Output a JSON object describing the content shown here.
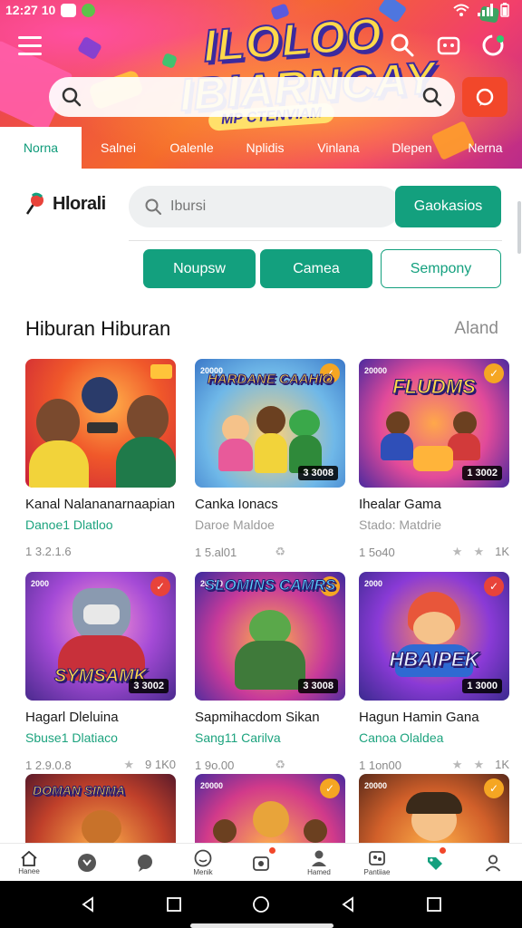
{
  "status_bar": {
    "time": "12:27 10"
  },
  "hero": {
    "title_line1": "ILOLOO",
    "title_line2": "IBIARNCAY",
    "subtitle": "MP CTENVIAM",
    "accent": "#f46a2a"
  },
  "categories": [
    {
      "label": "Norna",
      "active": true
    },
    {
      "label": "Salnei"
    },
    {
      "label": "Oalenle"
    },
    {
      "label": "Nplidis"
    },
    {
      "label": "Vinlana"
    },
    {
      "label": "Dlepen"
    },
    {
      "label": "Nerna"
    }
  ],
  "brand": {
    "name": "Hlorali"
  },
  "search": {
    "placeholder": "Ibursi",
    "button": "Gaokasios"
  },
  "filters": [
    "Noupsw",
    "Camea",
    "Sempony"
  ],
  "section": {
    "title": "Hiburan Hiburan",
    "link": "Aland"
  },
  "cards": [
    {
      "title": "Kanal Nalananarnaapiani,",
      "sub": "Danoe1 Dlatloo",
      "meta": "1 3.2.1.6",
      "tag": "",
      "badge": "",
      "art": ""
    },
    {
      "title": "Canka Ionacs",
      "sub": "Daroe Maldoe",
      "meta": "1 5.al01",
      "tag": "20000",
      "badge": "3 3008",
      "art": "HARDANE CAAHIO"
    },
    {
      "title": "Ihealar Gama",
      "sub": "Stado: Matdrie",
      "meta": "1 5o40",
      "tag": "20000",
      "badge": "1 3002",
      "art": "FLUDMS"
    },
    {
      "title": "Hagarl Dleluina",
      "sub": "Sbuse1 Dlatiaco",
      "meta": "1 2.9.0.8",
      "tag": "2000",
      "badge": "3 3002",
      "art": "SYMSAMK"
    },
    {
      "title": "Sapmihacdom Sikan",
      "sub": "Sang11 Carilva",
      "meta": "1 9o.00",
      "tag": "20000",
      "badge": "3 3008",
      "art": "SLOMINS CAMRS"
    },
    {
      "title": "Hagun Hamin Gana",
      "sub": "Canoa Olaldea",
      "meta": "1 1on00",
      "tag": "2000",
      "badge": "1 3000",
      "art": "HBAIPEK"
    },
    {
      "title": "",
      "sub": "",
      "meta": "",
      "tag": "",
      "badge": "",
      "art": "DOMAN SINMA"
    },
    {
      "title": "",
      "sub": "",
      "meta": "",
      "tag": "20000",
      "badge": "",
      "art": ""
    },
    {
      "title": "",
      "sub": "",
      "meta": "",
      "tag": "20000",
      "badge": "",
      "art": ""
    }
  ],
  "bottom_nav": [
    {
      "label": "Hanee",
      "icon": "home-icon"
    },
    {
      "label": "",
      "icon": "shield-icon"
    },
    {
      "label": "",
      "icon": "chat-icon"
    },
    {
      "label": "Menik",
      "icon": "emoji-icon"
    },
    {
      "label": "",
      "icon": "gift-icon"
    },
    {
      "label": "Hamed",
      "icon": "person-icon"
    },
    {
      "label": "Pantiiae",
      "icon": "gallery-icon"
    },
    {
      "label": "",
      "icon": "tag-icon"
    },
    {
      "label": "",
      "icon": "user-icon"
    }
  ],
  "colors": {
    "primary": "#13a07e",
    "accent": "#f2472a"
  }
}
